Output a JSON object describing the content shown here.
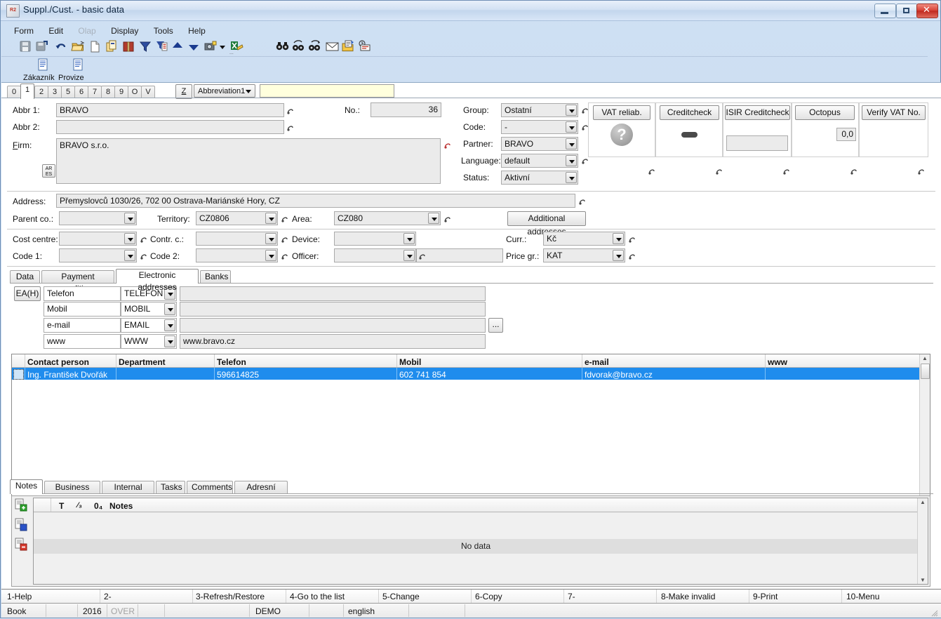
{
  "window": {
    "title": "Suppl./Cust. - basic data",
    "icon": "app-icon",
    "buttons": {
      "minimize": "minimize",
      "maximize": "maximize",
      "close": "close"
    }
  },
  "menubar": {
    "items": [
      {
        "label": "Form",
        "disabled": false
      },
      {
        "label": "Edit",
        "disabled": false
      },
      {
        "label": "Olap",
        "disabled": true
      },
      {
        "label": "Display",
        "disabled": false
      },
      {
        "label": "Tools",
        "disabled": false
      },
      {
        "label": "Help",
        "disabled": false
      }
    ]
  },
  "toolbar": {
    "items": [
      {
        "name": "save-icon"
      },
      {
        "name": "save-all-icon"
      },
      {
        "name": "undo-icon"
      },
      {
        "name": "open-folder-icon"
      },
      {
        "name": "new-document-icon"
      },
      {
        "name": "copy-icon"
      },
      {
        "name": "book-icon"
      },
      {
        "name": "filter-icon"
      },
      {
        "name": "filter-list-icon"
      },
      {
        "name": "arrow-up-icon"
      },
      {
        "name": "arrow-down-icon"
      },
      {
        "name": "camera-icon"
      },
      {
        "name": "dropdown-arrow-icon"
      },
      {
        "name": "excel-export-icon"
      },
      {
        "name": "find-icon"
      },
      {
        "name": "find-previous-icon"
      },
      {
        "name": "find-next-icon"
      },
      {
        "name": "mail-icon"
      },
      {
        "name": "edit-note-icon"
      },
      {
        "name": "history-icon"
      }
    ]
  },
  "bigbar": {
    "items": [
      {
        "label": "Zákazník",
        "icon": "document-icon"
      },
      {
        "label": "Provize",
        "icon": "document-icon"
      }
    ]
  },
  "numtabs": {
    "items": [
      "0",
      "1",
      "2",
      "3",
      "5",
      "6",
      "7",
      "8",
      "9",
      "O",
      "V"
    ],
    "active": "1",
    "z_button": "Z",
    "abbrev_select": "Abbreviation1",
    "abbrev_input": ""
  },
  "form": {
    "abbr1_label": "Abbr 1:",
    "abbr1_value": "BRAVO",
    "abbr2_label": "Abbr 2:",
    "abbr2_value": "",
    "firm_label": "Firm:",
    "firm_value": "BRAVO s.r.o.",
    "ares_button": "ARES",
    "no_label": "No.:",
    "no_value": "36",
    "group_label": "Group:",
    "group_value": "Ostatní",
    "code_label": "Code:",
    "code_value": "-",
    "partner_label": "Partner:",
    "partner_value": "BRAVO",
    "language_label": "Language:",
    "language_value": "default",
    "status_label": "Status:",
    "status_value": "Aktivní",
    "address_label": "Address:",
    "address_value": "Přemyslovců 1030/26, 702 00  Ostrava-Mariánské Hory, CZ",
    "parent_label": "Parent co.:",
    "parent_value": "",
    "territory_label": "Territory:",
    "territory_value": "CZ0806",
    "area_label": "Area:",
    "area_value": "CZ080",
    "additional_addresses_button": "Additional addresses",
    "cost_centre_label": "Cost centre:",
    "cost_centre_value": "",
    "contr_c_label": "Contr. c.:",
    "contr_c_value": "",
    "device_label": "Device:",
    "device_value": "",
    "curr_label": "Curr.:",
    "curr_value": "Kč",
    "code1_label": "Code 1:",
    "code1_value": "",
    "code2_label": "Code 2:",
    "code2_value": "",
    "officer_label": "Officer:",
    "officer_value": "",
    "price_gr_label": "Price gr.:",
    "price_gr_value": "KAT"
  },
  "checks": {
    "boxes": [
      {
        "button": "VAT reliab.",
        "indicator": "question-mark-icon",
        "value": ""
      },
      {
        "button": "Creditcheck",
        "indicator": "dash-icon",
        "value": ""
      },
      {
        "button": "ISIR Creditcheck",
        "indicator": "empty-field",
        "value": ""
      },
      {
        "button": "Octopus",
        "indicator": "value-field",
        "value": "0,0"
      },
      {
        "button": "Verify VAT No.",
        "indicator": "none",
        "value": ""
      }
    ]
  },
  "middle_tabs": {
    "items": [
      "Data",
      "Payment conditions",
      "Electronic addresses",
      "Banks"
    ],
    "active": "Electronic addresses"
  },
  "electronic_addresses": {
    "ea_button": "EA(H)",
    "browse_button": "...",
    "rows": [
      {
        "name": "Telefon",
        "type": "TELEFON",
        "value": ""
      },
      {
        "name": "Mobil",
        "type": "MOBIL",
        "value": ""
      },
      {
        "name": "e-mail",
        "type": "EMAIL",
        "value": ""
      },
      {
        "name": "www",
        "type": "WWW",
        "value": "www.bravo.cz"
      }
    ]
  },
  "contacts_grid": {
    "columns": [
      "Contact person",
      "Department",
      "Telefon",
      "Mobil",
      "e-mail",
      "www"
    ],
    "rows": [
      {
        "selected": true,
        "cells": [
          "Ing. František Dvořák",
          "",
          "596614825",
          "602 741 854",
          "fdvorak@bravo.cz",
          ""
        ]
      }
    ]
  },
  "bottom_tabs": {
    "items": [
      "Notes",
      "Business text",
      "Internal text",
      "Tasks",
      "Comments",
      "Adresní klíče"
    ],
    "active": "Notes"
  },
  "notes_panel": {
    "side_buttons": [
      {
        "name": "add-note-icon"
      },
      {
        "name": "edit-note-icon"
      },
      {
        "name": "delete-note-icon"
      }
    ],
    "columns": [
      "T",
      "⁄₃",
      "0₄",
      "Notes"
    ],
    "empty_text": "No data"
  },
  "fnbar": {
    "items": [
      "1-Help",
      "2-",
      "3-Refresh/Restore",
      "4-Go to the list",
      "5-Change",
      "6-Copy",
      "7-",
      "8-Make invalid",
      "9-Print",
      "10-Menu"
    ]
  },
  "statusbar": {
    "items": [
      {
        "text": "Book",
        "grey": false
      },
      {
        "text": "",
        "grey": false
      },
      {
        "text": "2016",
        "grey": false
      },
      {
        "text": "OVER",
        "grey": true
      },
      {
        "text": "",
        "grey": false
      },
      {
        "text": "",
        "grey": false
      },
      {
        "text": "DEMO",
        "grey": false
      },
      {
        "text": "",
        "grey": false
      },
      {
        "text": "english",
        "grey": false
      },
      {
        "text": "",
        "grey": false
      },
      {
        "text": "",
        "grey": false
      }
    ]
  },
  "colors": {
    "selection": "#1f8ced",
    "title_bg": "#d2e1f3",
    "field_bg": "#ebebeb",
    "highlight_input": "#ffffdd"
  }
}
